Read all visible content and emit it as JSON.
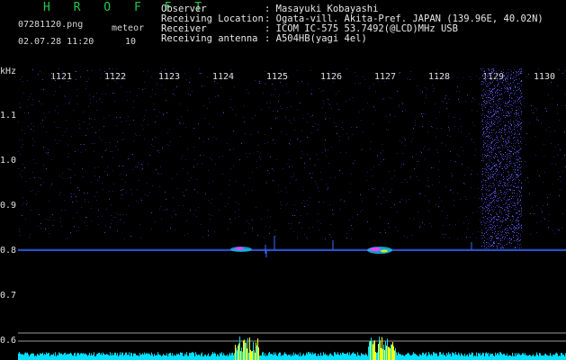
{
  "header": {
    "app_name": "H R O F F T",
    "filename": "07281120.png",
    "mode_label": "meteor",
    "datetime": "02.07.28 11:20",
    "meteor_count": "10"
  },
  "metadata": [
    {
      "label": "Observer",
      "value": ": Masayuki Kobayashi"
    },
    {
      "label": "Receiving Location",
      "value": ": Ogata-vill. Akita-Pref. JAPAN (139.96E, 40.02N)"
    },
    {
      "label": "Receiver",
      "value": ": ICOM IC-575 53.7492(@LCD)MHz USB"
    },
    {
      "label": "Receiving antenna",
      "value": ": A504HB(yagi 4el)"
    }
  ],
  "x_axis": {
    "ticks": [
      "1121",
      "1122",
      "1123",
      "1124",
      "1125",
      "1126",
      "1127",
      "1128",
      "1129",
      "1130"
    ]
  },
  "y_axis": {
    "unit": "kHz",
    "ticks": [
      "1.1",
      "1.0",
      "0.9",
      "0.8",
      "0.7",
      "0.6"
    ]
  },
  "colors": {
    "background": "#000000",
    "title": "#22c84a",
    "signal_line": "#3a6cff",
    "echo_head": "#ff3cff",
    "level_bars": "#00e0ff",
    "level_peaks": "#ffff00",
    "noise": "#2a2a8a"
  }
}
